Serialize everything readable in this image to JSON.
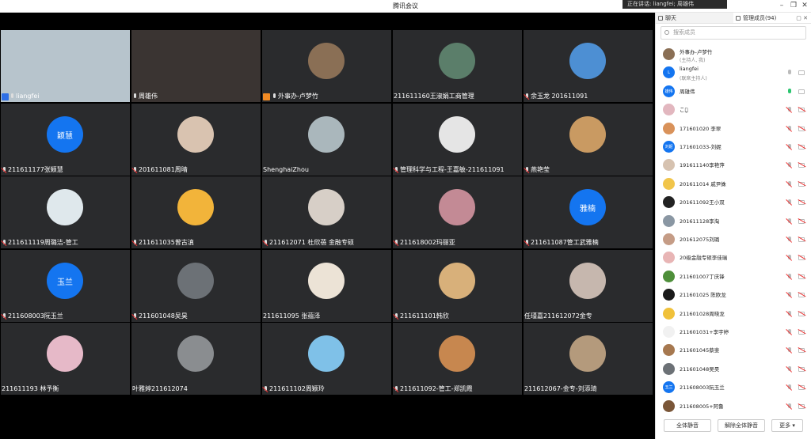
{
  "window": {
    "title": "腾讯会议",
    "speaking": "正在讲话: liangfei; 周雄伟"
  },
  "tiles": [
    {
      "label": "liangfei",
      "mic": "on",
      "host": true,
      "kind": "video",
      "bg": "#b7c4cc"
    },
    {
      "label": "周雄伟",
      "mic": "on",
      "kind": "video",
      "bg": "#3a3432"
    },
    {
      "label": "外事办-卢梦竹",
      "mic": "on",
      "cohost": true,
      "kind": "photo",
      "bg": "#8a6f55"
    },
    {
      "label": "211611160王淑娟工商管理",
      "mic": "none",
      "kind": "photo",
      "bg": "#5b7e6a"
    },
    {
      "label": "余玉龙 201611091",
      "mic": "off",
      "kind": "photo",
      "bg": "#4d8fd3"
    },
    {
      "label": "211611177张颖慧",
      "mic": "off",
      "kind": "text",
      "avatar_text": "颖慧"
    },
    {
      "label": "201611081周晴",
      "mic": "off",
      "kind": "photo",
      "bg": "#d9c3b0"
    },
    {
      "label": "ShenghaiZhou",
      "mic": "none",
      "kind": "photo",
      "bg": "#aab7bc"
    },
    {
      "label": "管理科学与工程-王嘉敏-211611091",
      "mic": "off",
      "kind": "photo",
      "bg": "#e5e5e5"
    },
    {
      "label": "燕艳莹",
      "mic": "off",
      "kind": "photo",
      "bg": "#c99a62"
    },
    {
      "label": "211611119周璐洁-管工",
      "mic": "off",
      "kind": "photo",
      "bg": "#dfe8ec"
    },
    {
      "label": "211611035曾古滇",
      "mic": "off",
      "kind": "photo",
      "bg": "#f2b43a"
    },
    {
      "label": "211612071 杜欣蓓 金融专硕",
      "mic": "off",
      "kind": "photo",
      "bg": "#d7cfc7"
    },
    {
      "label": "211618002玛丽亚",
      "mic": "off",
      "kind": "photo",
      "bg": "#c38a95"
    },
    {
      "label": "211611087管工武雅楠",
      "mic": "off",
      "kind": "text",
      "avatar_text": "雅楠"
    },
    {
      "label": "211608003阮玉兰",
      "mic": "off",
      "kind": "text",
      "avatar_text": "玉兰"
    },
    {
      "label": "211601048吴昊",
      "mic": "off",
      "kind": "photo",
      "bg": "#6c7176"
    },
    {
      "label": "211611095 张蕴泽",
      "mic": "none",
      "kind": "photo",
      "bg": "#ece3d6"
    },
    {
      "label": "211611101韩欣",
      "mic": "off",
      "kind": "photo",
      "bg": "#d8b07a"
    },
    {
      "label": "任瑾嘉211612072金专",
      "mic": "none",
      "kind": "photo",
      "bg": "#c6b7ae"
    },
    {
      "label": "211611193 林予衡",
      "mic": "none",
      "kind": "photo",
      "bg": "#e6b9c8"
    },
    {
      "label": "叶雅婷211612074",
      "mic": "none",
      "kind": "photo",
      "bg": "#8a8d90"
    },
    {
      "label": "211611102周颖玲",
      "mic": "off",
      "kind": "photo",
      "bg": "#7fc1e8"
    },
    {
      "label": "211611092-管工-郑凯霞",
      "mic": "off",
      "kind": "photo",
      "bg": "#c7874f"
    },
    {
      "label": "211612067-金专-刘添琦",
      "mic": "none",
      "kind": "photo",
      "bg": "#b49a7c"
    }
  ],
  "panel": {
    "tab_chat": "聊天",
    "tab_members": "管理成员(94)",
    "search_placeholder": "搜索成员",
    "members": [
      {
        "name": "外事办-卢梦竹",
        "sub": "(主持人, 我)",
        "mic": "none",
        "cam": "none",
        "av": "#8a6f55"
      },
      {
        "name": "liangfei",
        "sub": "(联席主持人)",
        "mic": "idle",
        "cam": "on",
        "av": "#1475f0",
        "av_text": "L"
      },
      {
        "name": "周雄伟",
        "sub": "",
        "mic": "active",
        "cam": "on",
        "av": "#1475f0",
        "av_text": "雄伟"
      },
      {
        "name": "こぐ̥",
        "sub": "",
        "mic": "muted",
        "cam": "muted",
        "av": "#e2b7bf"
      },
      {
        "name": "171601020 李翠",
        "sub": "",
        "mic": "muted",
        "cam": "muted",
        "av": "#d9925a"
      },
      {
        "name": "171601033-刘妮",
        "sub": "",
        "mic": "muted",
        "cam": "muted",
        "av": "#1475f0",
        "av_text": "刘妮"
      },
      {
        "name": "191611140李艳萍",
        "sub": "",
        "mic": "muted",
        "cam": "muted",
        "av": "#d6c2b0"
      },
      {
        "name": "201611014 戚尹姝",
        "sub": "",
        "mic": "muted",
        "cam": "muted",
        "av": "#f1c54a"
      },
      {
        "name": "201611092王小双",
        "sub": "",
        "mic": "muted",
        "cam": "muted",
        "av": "#222"
      },
      {
        "name": "201611128李淘",
        "sub": "",
        "mic": "muted",
        "cam": "muted",
        "av": "#8a97a3"
      },
      {
        "name": "201612075刘璐",
        "sub": "",
        "mic": "muted",
        "cam": "muted",
        "av": "#c59c86"
      },
      {
        "name": "20级金融专硕李佳瑞",
        "sub": "",
        "mic": "muted",
        "cam": "muted",
        "av": "#e8b5b5"
      },
      {
        "name": "211601007丁庆锋",
        "sub": "",
        "mic": "muted",
        "cam": "muted",
        "av": "#4e8f3a"
      },
      {
        "name": "211601025 陈欧龙",
        "sub": "",
        "mic": "muted",
        "cam": "muted",
        "av": "#1a1a1a"
      },
      {
        "name": "211601028周晓龙",
        "sub": "",
        "mic": "muted",
        "cam": "muted",
        "av": "#f0c13a"
      },
      {
        "name": "211601031+李宇婷",
        "sub": "",
        "mic": "muted",
        "cam": "muted",
        "av": "#f1f1f1"
      },
      {
        "name": "211601045蔡斐",
        "sub": "",
        "mic": "muted",
        "cam": "muted",
        "av": "#a6784f"
      },
      {
        "name": "211601048吴昊",
        "sub": "",
        "mic": "muted",
        "cam": "muted",
        "av": "#6c7176"
      },
      {
        "name": "211608003阮玉兰",
        "sub": "",
        "mic": "muted",
        "cam": "muted",
        "av": "#1475f0",
        "av_text": "玉兰"
      },
      {
        "name": "211608005+阿鲁",
        "sub": "",
        "mic": "muted",
        "cam": "muted",
        "av": "#7a5638"
      }
    ],
    "btn_mute_all": "全体静音",
    "btn_unmute_all": "解除全体静音",
    "btn_more": "更多 ▾"
  }
}
